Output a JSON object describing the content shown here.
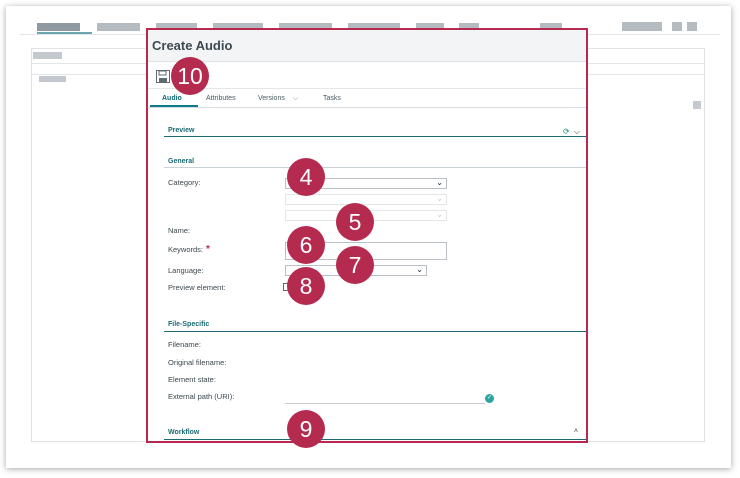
{
  "dialog": {
    "title": "Create Audio",
    "tabs": [
      "Audio",
      "Attributes",
      "Versions",
      "Tasks"
    ],
    "versions_chevron": "⌵"
  },
  "preview": {
    "section_title": "Preview",
    "refresh_icon": "refresh-icon",
    "chevron": "⌵"
  },
  "general": {
    "section_title": "General",
    "category_label": "Category:",
    "name_label": "Name:",
    "keywords_label": "Keywords:",
    "required_mark": "*",
    "language_label": "Language:",
    "preview_element_label": "Preview element:"
  },
  "file_specific": {
    "section_title": "File-Specific",
    "filename_label": "Filename:",
    "original_filename_label": "Original filename:",
    "element_state_label": "Element state:",
    "external_path_label": "External path (URI):"
  },
  "workflow": {
    "section_title": "Workflow",
    "chevron": "˄"
  },
  "badges": [
    "4",
    "5",
    "6",
    "7",
    "8",
    "9",
    "10"
  ],
  "colors": {
    "accent": "#b52a4f",
    "teal": "#1b6b74",
    "header_bg": "#f3f4f5"
  }
}
